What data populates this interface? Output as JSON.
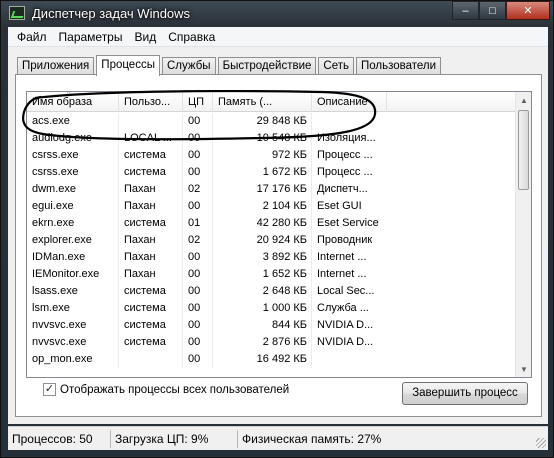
{
  "window": {
    "title": "Диспетчер задач Windows",
    "minimize_glyph": "–",
    "maximize_glyph": "□",
    "close_glyph": "✕"
  },
  "menu": [
    "Файл",
    "Параметры",
    "Вид",
    "Справка"
  ],
  "tabs": [
    "Приложения",
    "Процессы",
    "Службы",
    "Быстродействие",
    "Сеть",
    "Пользователи"
  ],
  "active_tab": "Процессы",
  "columns": [
    "Имя образа",
    "Пользо...",
    "ЦП",
    "Память (...",
    "Описание"
  ],
  "processes": [
    {
      "name": "acs.exe",
      "user": "",
      "cpu": "00",
      "memory": "29 848 КБ",
      "description": ""
    },
    {
      "name": "audiodg.exe",
      "user": "LOCAL ...",
      "cpu": "00",
      "memory": "10 548 КБ",
      "description": "Изоляция..."
    },
    {
      "name": "csrss.exe",
      "user": "система",
      "cpu": "00",
      "memory": "972 КБ",
      "description": "Процесс ..."
    },
    {
      "name": "csrss.exe",
      "user": "система",
      "cpu": "00",
      "memory": "1 672 КБ",
      "description": "Процесс ..."
    },
    {
      "name": "dwm.exe",
      "user": "Пахан",
      "cpu": "02",
      "memory": "17 176 КБ",
      "description": "Диспетч..."
    },
    {
      "name": "egui.exe",
      "user": "Пахан",
      "cpu": "00",
      "memory": "2 104 КБ",
      "description": "Eset GUI"
    },
    {
      "name": "ekrn.exe",
      "user": "система",
      "cpu": "01",
      "memory": "42 280 КБ",
      "description": "Eset Service"
    },
    {
      "name": "explorer.exe",
      "user": "Пахан",
      "cpu": "02",
      "memory": "20 924 КБ",
      "description": "Проводник"
    },
    {
      "name": "IDMan.exe",
      "user": "Пахан",
      "cpu": "00",
      "memory": "3 892 КБ",
      "description": "Internet ..."
    },
    {
      "name": "IEMonitor.exe",
      "user": "Пахан",
      "cpu": "00",
      "memory": "1 652 КБ",
      "description": "Internet ..."
    },
    {
      "name": "lsass.exe",
      "user": "система",
      "cpu": "00",
      "memory": "2 648 КБ",
      "description": "Local Sec..."
    },
    {
      "name": "lsm.exe",
      "user": "система",
      "cpu": "00",
      "memory": "1 000 КБ",
      "description": "Служба ..."
    },
    {
      "name": "nvvsvc.exe",
      "user": "система",
      "cpu": "00",
      "memory": "844 КБ",
      "description": "NVIDIA D..."
    },
    {
      "name": "nvvsvc.exe",
      "user": "система",
      "cpu": "00",
      "memory": "2 876 КБ",
      "description": "NVIDIA D..."
    },
    {
      "name": "op_mon.exe",
      "user": "",
      "cpu": "00",
      "memory": "16 492 КБ",
      "description": ""
    }
  ],
  "show_all_users": {
    "label": "Отображать процессы всех пользователей",
    "checked": true,
    "check_glyph": "✓"
  },
  "end_process_button": "Завершить процесс",
  "status": {
    "processes": "Процессов: 50",
    "cpu": "Загрузка ЦП: 9%",
    "memory": "Физическая память: 27%"
  },
  "scroll_glyphs": {
    "up": "▲",
    "down": "▼",
    "sort": "^"
  },
  "annotation_color": "#000000"
}
